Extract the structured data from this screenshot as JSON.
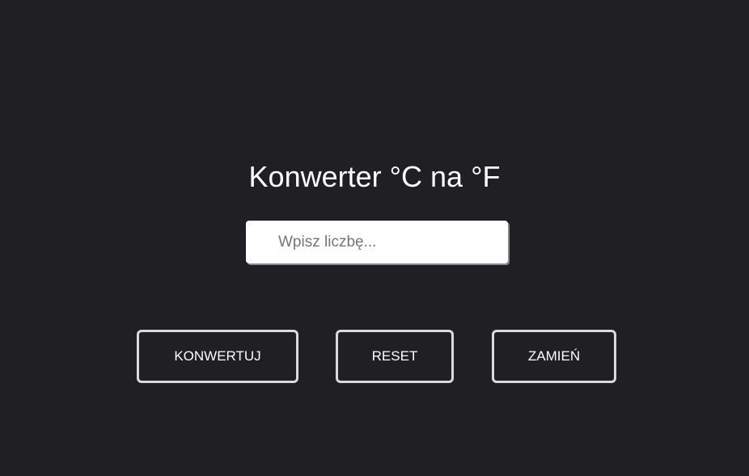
{
  "page": {
    "title": "Konwerter °C na °F",
    "background_color": "#1f1f24",
    "text_color": "#ffffff"
  },
  "input": {
    "value": "",
    "placeholder": "Wpisz liczbę..."
  },
  "buttons": {
    "convert_label": "KONWERTUJ",
    "reset_label": "RESET",
    "swap_label": "ZAMIEŃ",
    "border_color": "#d9d9de"
  }
}
